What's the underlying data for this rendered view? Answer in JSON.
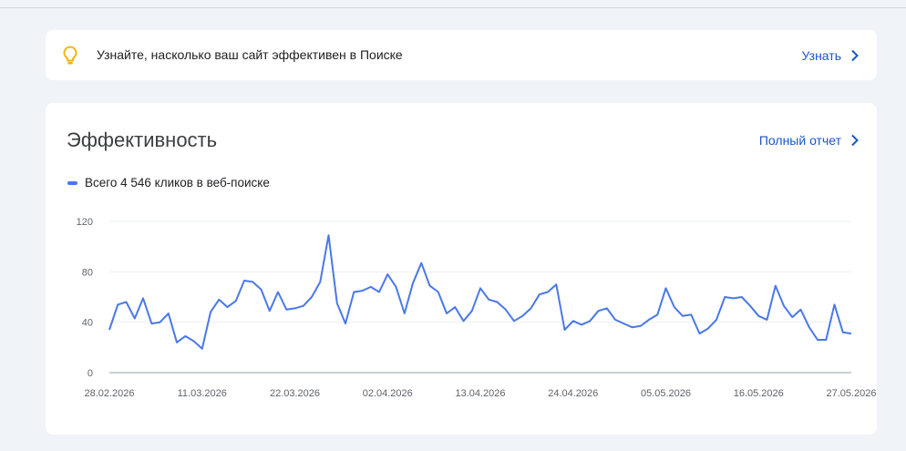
{
  "banner": {
    "text": "Узнайте, насколько ваш сайт эффективен в Поиске",
    "link_label": "Узнать",
    "icon": "lightbulb-icon"
  },
  "performance": {
    "title": "Эффективность",
    "full_report_label": "Полный отчет",
    "legend_label": "Всего 4 546 кликов в веб-поиске"
  },
  "colors": {
    "accent": "#1a55c9",
    "series": "#4a78e6",
    "bulb": "#f2b50c"
  },
  "chart_data": {
    "type": "line",
    "title": "",
    "xlabel": "",
    "ylabel": "",
    "ylim": [
      0,
      120
    ],
    "yticks": [
      0,
      40,
      80,
      120
    ],
    "grid": true,
    "xtick_labels": [
      "28.02.2026",
      "11.03.2026",
      "22.03.2026",
      "02.04.2026",
      "13.04.2026",
      "24.04.2026",
      "05.05.2026",
      "16.05.2026",
      "27.05.2026"
    ],
    "x_start": "28.02.2026",
    "series": [
      {
        "name": "Всего 4 546 кликов в веб-поиске",
        "values": [
          34,
          54,
          56,
          43,
          59,
          39,
          40,
          47,
          24,
          29,
          25,
          19,
          48,
          58,
          52,
          57,
          73,
          72,
          66,
          49,
          64,
          50,
          51,
          53,
          60,
          72,
          109,
          55,
          39,
          64,
          65,
          68,
          64,
          78,
          68,
          47,
          71,
          87,
          69,
          64,
          47,
          52,
          41,
          49,
          67,
          58,
          56,
          50,
          41,
          45,
          51,
          62,
          64,
          70,
          34,
          41,
          38,
          41,
          49,
          51,
          42,
          39,
          36,
          37,
          42,
          46,
          67,
          52,
          45,
          46,
          31,
          35,
          42,
          60,
          59,
          60,
          53,
          45,
          42,
          69,
          53,
          44,
          50,
          36,
          26,
          26,
          54,
          32,
          31
        ]
      }
    ]
  }
}
